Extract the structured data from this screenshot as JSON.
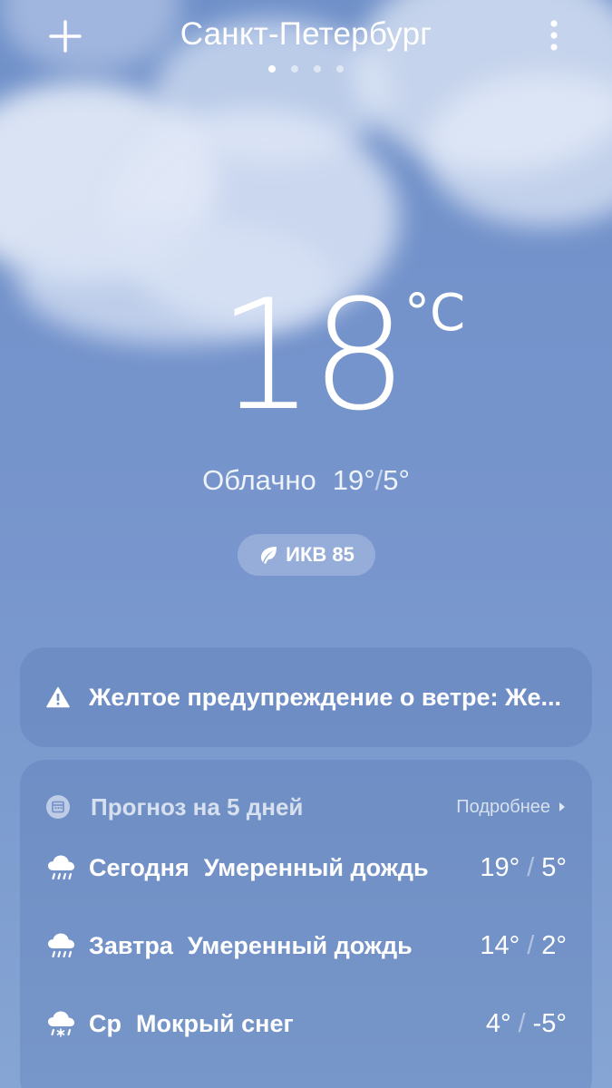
{
  "header": {
    "city": "Санкт-Петербург",
    "add_icon": "plus-icon",
    "menu_icon": "more-vertical-icon",
    "page_count": 4,
    "active_page": 1
  },
  "current": {
    "temperature": "18",
    "unit": "°C",
    "condition": "Облачно",
    "high": "19°",
    "low": "5°",
    "separator": "/"
  },
  "aqi": {
    "icon": "leaf-icon",
    "label": "ИКВ 85"
  },
  "alert": {
    "icon": "warning-triangle-icon",
    "text": "Желтое предупреждение о ветре: Же..."
  },
  "forecast": {
    "icon": "calendar-icon",
    "title": "Прогноз на 5 дней",
    "more_label": "Подробнее",
    "separator": "/",
    "days": [
      {
        "day": "Сегодня",
        "condition": "Умеренный дождь",
        "high": "19°",
        "low": "5°",
        "icon": "rain-cloud-icon"
      },
      {
        "day": "Завтра",
        "condition": "Умеренный дождь",
        "high": "14°",
        "low": "2°",
        "icon": "rain-cloud-icon"
      },
      {
        "day": "Ср",
        "condition": "Мокрый снег",
        "high": "4°",
        "low": "-5°",
        "icon": "sleet-cloud-icon"
      }
    ]
  },
  "colors": {
    "sky_top": "#6f90c9",
    "sky_bottom": "#86a5d4",
    "text": "#ffffff"
  }
}
